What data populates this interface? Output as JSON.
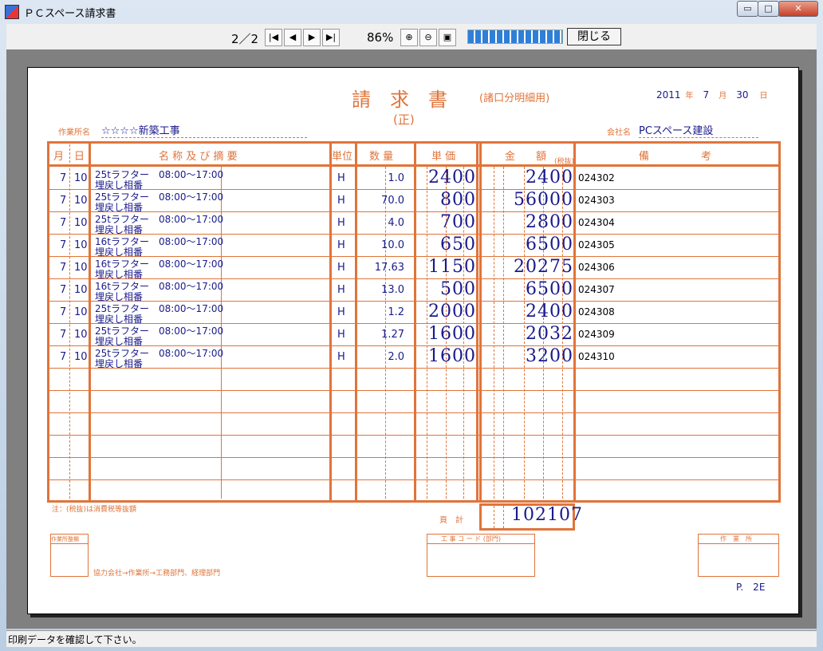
{
  "window": {
    "title": "ＰＣスペース請求書",
    "min": "▭",
    "max": "□",
    "close": "✕"
  },
  "toolbar": {
    "page": "2／2",
    "zoom": "86%",
    "close_label": "閉じる",
    "nav": [
      "|◀",
      "◀",
      "▶",
      "▶|"
    ]
  },
  "status": "印刷データを確認して下さい。",
  "invoice": {
    "title": "請　求　書",
    "kind": "(正)",
    "title_note": "(諸口分明細用)",
    "date": {
      "year": "2011",
      "year_unit": "年",
      "month": "7",
      "month_unit": "月",
      "day": "30",
      "day_unit": "日"
    },
    "site_label": "作業所名",
    "site_name": "☆☆☆☆新築工事",
    "company_label": "会社名",
    "company_name": "PCスペース建設",
    "headers": {
      "month": "月",
      "day": "日",
      "desc": "名 称 及 び 摘 要",
      "unit": "単位",
      "qty": "数 量",
      "price": "単 価",
      "amount": "金　　額",
      "tax": "(税抜)",
      "note": "備　　　　　考"
    },
    "rows": [
      {
        "m": "7",
        "d": "10",
        "l1": "25tラフター　08:00〜17:00",
        "l2": "埋戻し相番",
        "u": "H",
        "q": "1.0",
        "p": "2400",
        "a": "2400",
        "n": "024302"
      },
      {
        "m": "7",
        "d": "10",
        "l1": "25tラフター　08:00〜17:00",
        "l2": "埋戻し相番",
        "u": "H",
        "q": "70.0",
        "p": "800",
        "a": "56000",
        "n": "024303"
      },
      {
        "m": "7",
        "d": "10",
        "l1": "25tラフター　08:00〜17:00",
        "l2": "埋戻し相番",
        "u": "H",
        "q": "4.0",
        "p": "700",
        "a": "2800",
        "n": "024304"
      },
      {
        "m": "7",
        "d": "10",
        "l1": "16tラフター　08:00〜17:00",
        "l2": "埋戻し相番",
        "u": "H",
        "q": "10.0",
        "p": "650",
        "a": "6500",
        "n": "024305"
      },
      {
        "m": "7",
        "d": "10",
        "l1": "16tラフター　08:00〜17:00",
        "l2": "埋戻し相番",
        "u": "H",
        "q": "17.63",
        "p": "1150",
        "a": "20275",
        "n": "024306"
      },
      {
        "m": "7",
        "d": "10",
        "l1": "16tラフター　08:00〜17:00",
        "l2": "埋戻し相番",
        "u": "H",
        "q": "13.0",
        "p": "500",
        "a": "6500",
        "n": "024307"
      },
      {
        "m": "7",
        "d": "10",
        "l1": "25tラフター　08:00〜17:00",
        "l2": "埋戻し相番",
        "u": "H",
        "q": "1.2",
        "p": "2000",
        "a": "2400",
        "n": "024308"
      },
      {
        "m": "7",
        "d": "10",
        "l1": "25tラフター　08:00〜17:00",
        "l2": "埋戻し相番",
        "u": "H",
        "q": "1.27",
        "p": "1600",
        "a": "2032",
        "n": "024309"
      },
      {
        "m": "7",
        "d": "10",
        "l1": "25tラフター　08:00〜17:00",
        "l2": "埋戻し相番",
        "u": "H",
        "q": "2.0",
        "p": "1600",
        "a": "3200",
        "n": "024310"
      }
    ],
    "footnote": "注：(税抜)は消費税等抜額",
    "page_total_label": "頁　計",
    "page_total": "102107",
    "stamp_label": "作業所整欄",
    "route": "協力会社→作業所→工務部門、経理部門",
    "code_label": "工 事 コ ー ド (部門)",
    "office_label": "作　業　所",
    "page_no": "P.　2E"
  }
}
